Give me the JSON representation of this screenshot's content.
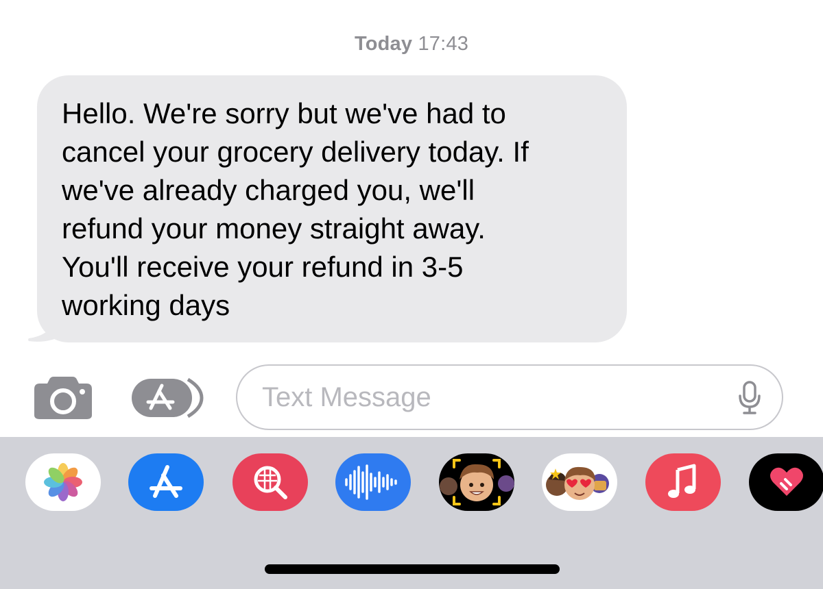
{
  "conversation": {
    "timestamp_day": "Today",
    "timestamp_time": "17:43",
    "messages": [
      {
        "direction": "incoming",
        "text": "Hello. We're sorry but we've had to\ncancel your grocery delivery today. If\nwe've already charged you, we'll\nrefund your money straight away.\nYou'll receive your refund in 3-5\nworking days"
      }
    ]
  },
  "composer": {
    "placeholder": "Text Message",
    "value": "",
    "camera_icon": "camera-icon",
    "apps_icon": "app-store-icon",
    "mic_icon": "microphone-icon"
  },
  "app_drawer": {
    "background": "#d1d2d8",
    "apps": [
      {
        "icon": "photos-icon",
        "bg": "#ffffff"
      },
      {
        "icon": "app-store-icon",
        "bg": "#1d7cf2"
      },
      {
        "icon": "image-search-icon",
        "bg": "#e8415a"
      },
      {
        "icon": "audio-message-icon",
        "bg": "#2f7bf0"
      },
      {
        "icon": "memoji-icon",
        "bg": "#000000"
      },
      {
        "icon": "memoji-stickers-icon",
        "bg": "#ffffff"
      },
      {
        "icon": "music-icon",
        "bg": "#ee4a5b"
      },
      {
        "icon": "digital-touch-icon",
        "bg": "#000000"
      }
    ]
  },
  "colors": {
    "incoming_bubble": "#e9e9eb",
    "timestamp_text": "#8e8e93",
    "icon_gray": "#8e8e93"
  }
}
